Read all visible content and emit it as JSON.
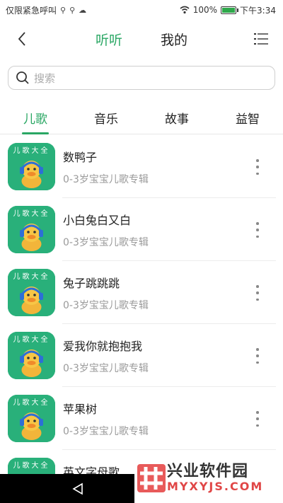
{
  "status_bar": {
    "carrier_text": "仅限紧急呼叫",
    "battery_percent": "100%",
    "battery_level": 1.0,
    "time": "下午3:34"
  },
  "header": {
    "tabs": [
      {
        "label": "听听",
        "active": true
      },
      {
        "label": "我的",
        "active": false
      }
    ],
    "back_icon": "chevron-left-icon",
    "menu_icon": "list-menu-icon"
  },
  "search": {
    "placeholder": "搜索"
  },
  "categories": [
    {
      "label": "儿歌",
      "active": true
    },
    {
      "label": "音乐",
      "active": false
    },
    {
      "label": "故事",
      "active": false
    },
    {
      "label": "益智",
      "active": false
    }
  ],
  "albums": [
    {
      "title": "数鸭子",
      "subtitle": "0-3岁宝宝儿歌专辑",
      "cover_text": "儿歌大全"
    },
    {
      "title": "小白兔白又白",
      "subtitle": "0-3岁宝宝儿歌专辑",
      "cover_text": "儿歌大全"
    },
    {
      "title": "兔子跳跳跳",
      "subtitle": "0-3岁宝宝儿歌专辑",
      "cover_text": "儿歌大全"
    },
    {
      "title": "爱我你就抱抱我",
      "subtitle": "0-3岁宝宝儿歌专辑",
      "cover_text": "儿歌大全"
    },
    {
      "title": "苹果树",
      "subtitle": "0-3岁宝宝儿歌专辑",
      "cover_text": "儿歌大全"
    },
    {
      "title": "英文字母歌",
      "subtitle": "",
      "cover_text": "儿歌大全"
    }
  ],
  "watermark": {
    "name": "兴业软件园",
    "url": "MYXYJS.COM"
  },
  "colors": {
    "accent": "#2aa764",
    "cover_bg": "#29b07a"
  }
}
